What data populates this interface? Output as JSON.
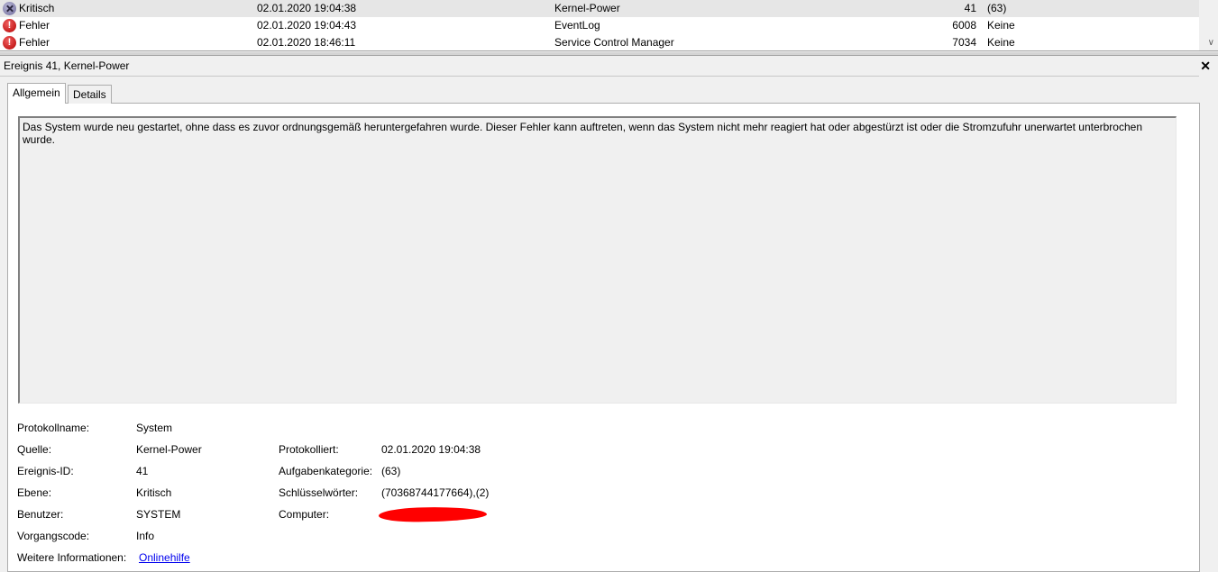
{
  "events": [
    {
      "level": "Kritisch",
      "level_icon": "critical-icon",
      "date": "02.01.2020 19:04:38",
      "source": "Kernel-Power",
      "event_id": "41",
      "task": "(63)",
      "selected": true
    },
    {
      "level": "Fehler",
      "level_icon": "error-icon",
      "date": "02.01.2020 19:04:43",
      "source": "EventLog",
      "event_id": "6008",
      "task": "Keine",
      "selected": false
    },
    {
      "level": "Fehler",
      "level_icon": "error-icon",
      "date": "02.01.2020 18:46:11",
      "source": "Service Control Manager",
      "event_id": "7034",
      "task": "Keine",
      "selected": false
    }
  ],
  "detail": {
    "title": "Ereignis 41, Kernel-Power",
    "close_label": "✕",
    "tabs": [
      "Allgemein",
      "Details"
    ],
    "description": "Das System wurde neu gestartet, ohne dass es zuvor ordnungsgemäß heruntergefahren wurde. Dieser Fehler kann auftreten, wenn das System nicht mehr reagiert hat oder abgestürzt ist oder die Stromzufuhr unerwartet unterbrochen wurde.",
    "fields": {
      "log_name_label": "Protokollname:",
      "log_name": "System",
      "source_label": "Quelle:",
      "source": "Kernel-Power",
      "logged_label": "Protokolliert:",
      "logged": "02.01.2020 19:04:38",
      "event_id_label": "Ereignis-ID:",
      "event_id": "41",
      "task_category_label": "Aufgabenkategorie:",
      "task_category": "(63)",
      "level_label": "Ebene:",
      "level": "Kritisch",
      "keywords_label": "Schlüsselwörter:",
      "keywords": "(70368744177664),(2)",
      "user_label": "Benutzer:",
      "user": "SYSTEM",
      "computer_label": "Computer:",
      "opcode_label": "Vorgangscode:",
      "opcode": "Info",
      "more_info_label": "Weitere Informationen:",
      "more_info_link": "Onlinehilfe"
    }
  },
  "colors": {
    "redaction": "#ff0000",
    "link": "#0000ee"
  }
}
